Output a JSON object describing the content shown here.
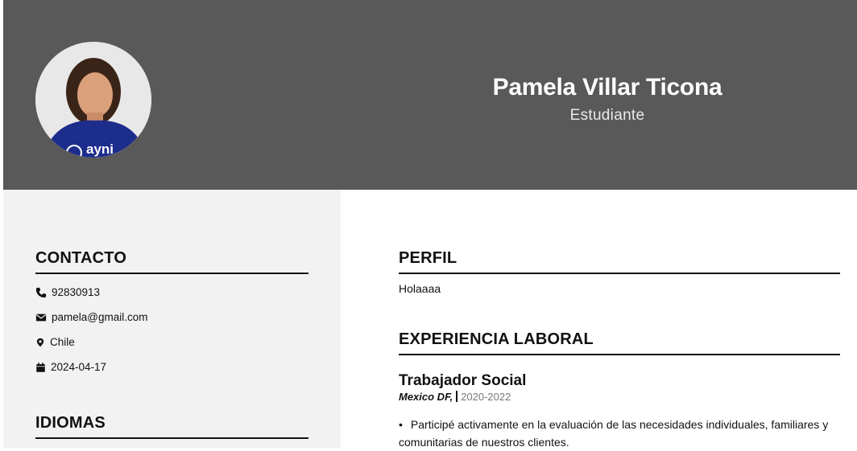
{
  "profile": {
    "name": "Pamela Villar Ticona",
    "role": "Estudiante",
    "photo_text": "ayni"
  },
  "contact": {
    "title": "CONTACTO",
    "phone": "92830913",
    "email": "pamela@gmail.com",
    "location": "Chile",
    "date": "2024-04-17"
  },
  "languages": {
    "title": "IDIOMAS"
  },
  "perfil": {
    "title": "PERFIL",
    "text": "Holaaaa"
  },
  "experience": {
    "title": "EXPERIENCIA LABORAL",
    "jobs": [
      {
        "title": "Trabajador Social",
        "place": "Mexico DF,",
        "years": "2020-2022",
        "bullet": "Participé activamente en la evaluación de las necesidades individuales, familiares y comunitarias de nuestros clientes."
      }
    ]
  },
  "icons": {
    "phone": "phone-icon",
    "email": "envelope-icon",
    "location": "map-pin-icon",
    "date": "calendar-icon"
  },
  "colors": {
    "header_bg": "#595959",
    "sidebar_bg": "#f2f2f2",
    "text": "#111111"
  }
}
